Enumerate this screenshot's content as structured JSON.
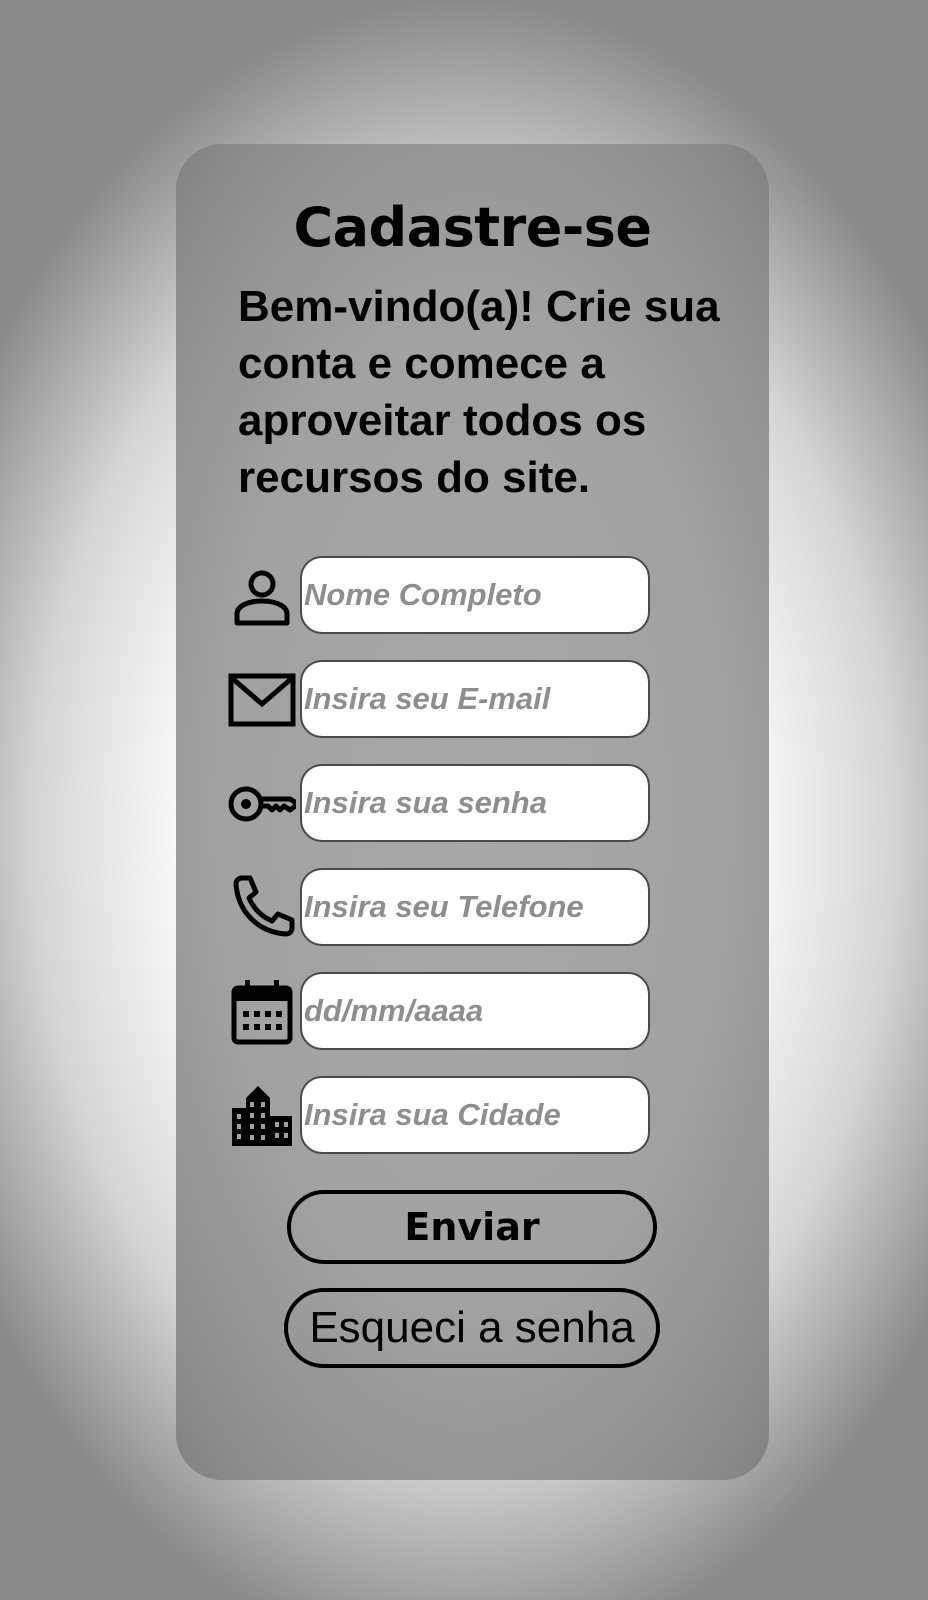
{
  "form": {
    "title": "Cadastre-se",
    "subtitle": "Bem-vindo(a)! Crie sua conta e comece a aproveitar todos os recursos do site.",
    "fields": [
      {
        "icon": "person-icon",
        "placeholder": "Nome Completo",
        "value": ""
      },
      {
        "icon": "mail-icon",
        "placeholder": "Insira seu E-mail",
        "value": ""
      },
      {
        "icon": "key-icon",
        "placeholder": "Insira sua senha",
        "value": ""
      },
      {
        "icon": "phone-icon",
        "placeholder": "Insira seu Telefone",
        "value": ""
      },
      {
        "icon": "calendar-icon",
        "placeholder": "dd/mm/aaaa",
        "value": ""
      },
      {
        "icon": "city-icon",
        "placeholder": "Insira sua Cidade",
        "value": ""
      }
    ],
    "submit_label": "Enviar",
    "forgot_label": "Esqueci a senha"
  },
  "colors": {
    "card_background": "#a1a1a1",
    "input_background": "#ffffff",
    "placeholder": "#8e8e8e",
    "text": "#000000"
  }
}
